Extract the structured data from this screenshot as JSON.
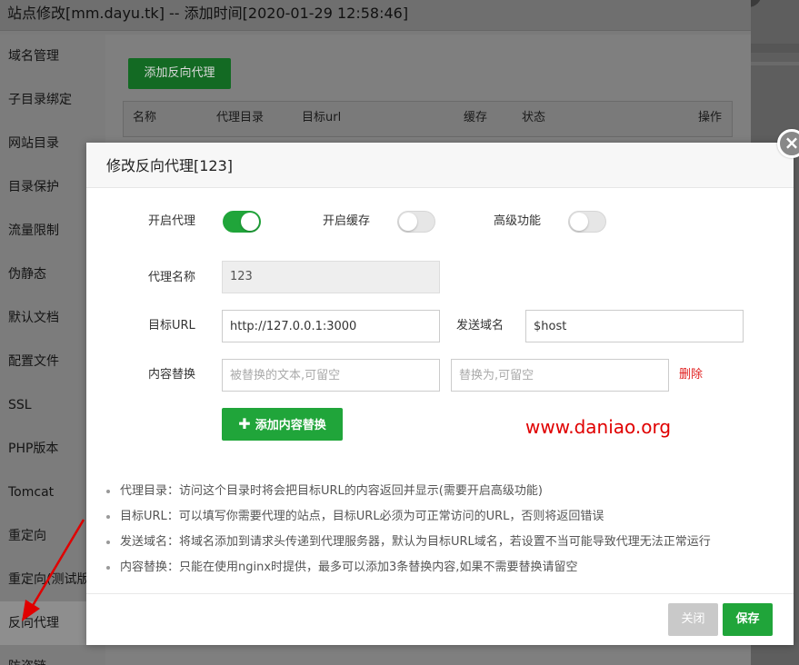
{
  "background": {
    "title": "站点修改[mm.dayu.tk] -- 添加时间[2020-01-29 12:58:46]",
    "sidebar": [
      {
        "label": "域名管理"
      },
      {
        "label": "子目录绑定"
      },
      {
        "label": "网站目录"
      },
      {
        "label": "目录保护"
      },
      {
        "label": "流量限制"
      },
      {
        "label": "伪静态"
      },
      {
        "label": "默认文档"
      },
      {
        "label": "配置文件"
      },
      {
        "label": "SSL"
      },
      {
        "label": "PHP版本"
      },
      {
        "label": "Tomcat"
      },
      {
        "label": "重定向"
      },
      {
        "label": "重定向(测试版)"
      },
      {
        "label": "反向代理"
      },
      {
        "label": "防盗链"
      }
    ],
    "add_button": "添加反向代理",
    "table_headers": [
      "名称",
      "代理目录",
      "目标url",
      "缓存",
      "状态",
      "操作"
    ]
  },
  "modal": {
    "title": "修改反向代理[123]",
    "toggles": [
      {
        "label": "开启代理",
        "state": "on"
      },
      {
        "label": "开启缓存",
        "state": "off"
      },
      {
        "label": "高级功能",
        "state": "off"
      }
    ],
    "proxy_name_label": "代理名称",
    "proxy_name_value": "123",
    "target_url_label": "目标URL",
    "target_url_value": "http://127.0.0.1:3000",
    "send_domain_label": "发送域名",
    "send_domain_value": "$host",
    "replace_label": "内容替换",
    "replace_from_placeholder": "被替换的文本,可留空",
    "replace_to_placeholder": "替换为,可留空",
    "delete_label": "删除",
    "add_replace_button": "添加内容替换",
    "watermark": "www.daniao.org",
    "notes": [
      "代理目录：访问这个目录时将会把目标URL的内容返回并显示(需要开启高级功能)",
      "目标URL：可以填写你需要代理的站点，目标URL必须为可正常访问的URL，否则将返回错误",
      "发送域名：将域名添加到请求头传递到代理服务器，默认为目标URL域名，若设置不当可能导致代理无法正常运行",
      "内容替换：只能在使用nginx时提供，最多可以添加3条替换内容,如果不需要替换请留空"
    ],
    "close_button": "关闭",
    "save_button": "保存",
    "close_icon_glyph": "×"
  },
  "colors": {
    "accent_green": "#20a53a",
    "danger_red": "#e02020",
    "annotation_red": "#e00000"
  }
}
